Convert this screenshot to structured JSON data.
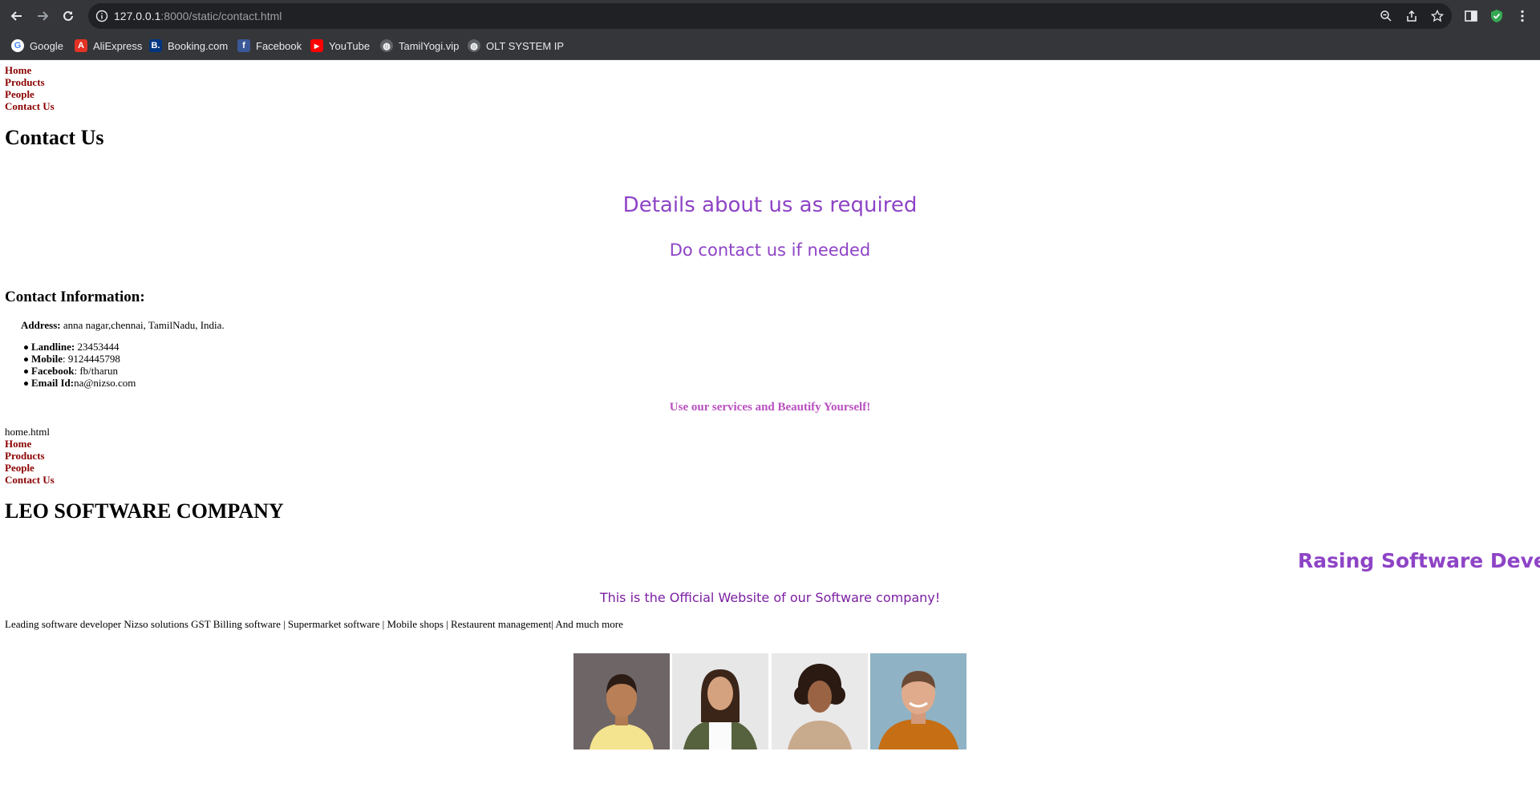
{
  "browser": {
    "url_host": "127.0.0.1",
    "url_rest": ":8000/static/contact.html",
    "bookmarks": [
      {
        "label": "Google"
      },
      {
        "label": "AliExpress"
      },
      {
        "label": "Booking.com"
      },
      {
        "label": "Facebook"
      },
      {
        "label": "YouTube"
      },
      {
        "label": "TamilYogi.vip"
      },
      {
        "label": "OLT SYSTEM IP"
      }
    ]
  },
  "nav_top": {
    "items": [
      "Home",
      "Products",
      "People",
      "Contact Us"
    ]
  },
  "contact": {
    "title": "Contact Us",
    "heading1": "Details about us as required",
    "heading2": "Do contact us if needed",
    "info_title": "Contact Information:",
    "address_label": "Address:",
    "address_value": " anna nagar,chennai, TamilNadu, India.",
    "items": [
      {
        "label": "Landline:",
        "value": " 23453444"
      },
      {
        "label": "Mobile",
        "value": ": 9124445798"
      },
      {
        "label": "Facebook",
        "value": ": fb/tharun"
      },
      {
        "label": "Email Id:",
        "value": "na@nizso.com"
      }
    ],
    "tagline": "Use our services and Beautify Yourself!"
  },
  "embedded": {
    "filename": "home.html",
    "nav_items": [
      "Home",
      "Products",
      "People",
      "Contact Us"
    ],
    "company": "LEO SOFTWARE COMPANY",
    "marquee": "Rasing Software Develo",
    "official": "This is the Official Website of our Software company!",
    "description": "Leading software developer Nizso solutions GST Billing software | Supermarket software | Mobile shops | Restaurent management| And much more"
  },
  "colors": {
    "link": "#8b0000",
    "purple": "#8e44c6",
    "tagline": "#b94fc0",
    "official": "#7b1fa2"
  },
  "icons": [
    "back-arrow-icon",
    "forward-arrow-icon",
    "reload-icon",
    "info-icon",
    "zoom-icon",
    "share-icon",
    "star-icon",
    "sidepanel-icon",
    "extension-shield-icon",
    "menu-dots-icon"
  ]
}
